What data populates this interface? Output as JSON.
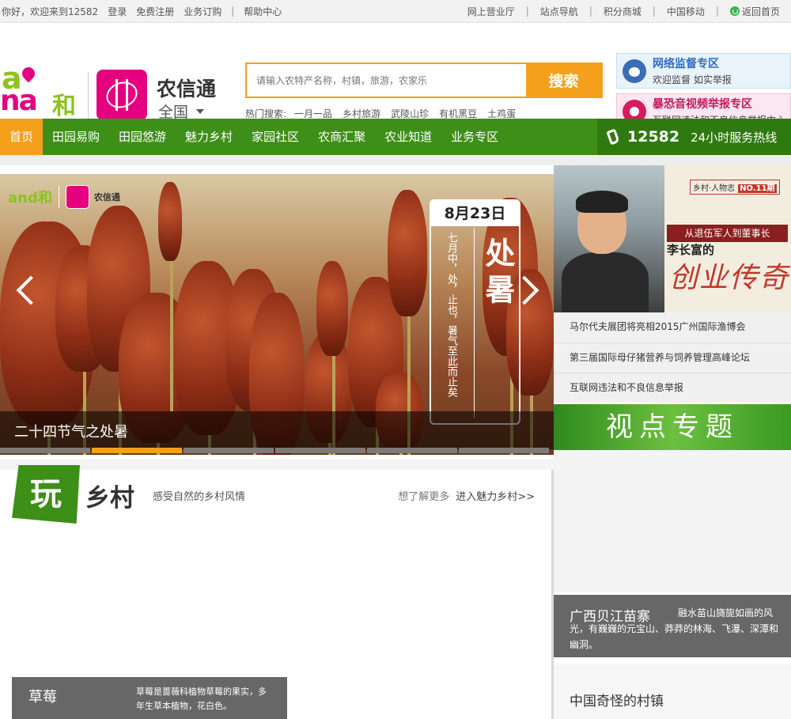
{
  "topbar": {
    "welcome": "你好，欢迎来到12582",
    "login": "登录",
    "register": "免费注册",
    "subscribe": "业务订购",
    "help": "帮助中心",
    "hall": "网上营业厅",
    "sitenav": "站点导航",
    "points": "积分商城",
    "cmcc": "中国移动",
    "home": "返回首页"
  },
  "header": {
    "logo_a": "a",
    "logo_na": "na",
    "logo_he": "和",
    "brand": "农信通",
    "region": "全国",
    "search_placeholder": "请输入农特产名称，村镇，旅游，农家乐",
    "search_button": "搜索",
    "hot_label": "热门搜索:",
    "hot_items": [
      "一月一品",
      "乡村旅游",
      "武陵山珍",
      "有机黑豆",
      "土鸡蛋"
    ]
  },
  "promos": [
    {
      "title": "网络监督专区",
      "subtitle": "欢迎监督 如实举报"
    },
    {
      "title": "暴恐音视频举报专区",
      "subtitle": "互联网违法和不良信息举报中心"
    }
  ],
  "nav": {
    "items": [
      "首页",
      "田园易购",
      "田园悠游",
      "魅力乡村",
      "家园社区",
      "农商汇聚",
      "农业知道",
      "业务专区"
    ],
    "hotline_number": "12582",
    "hotline_text": "24小时服务热线"
  },
  "slider": {
    "logo_and": "and和",
    "logo_name": "农信通",
    "date": "8月23日",
    "poem": "七月中，处，止也，暑气至此而止矣",
    "term": "处暑",
    "caption": "二十四节气之处暑",
    "active_index": 1,
    "dot_count": 6
  },
  "feature": {
    "magazine": "乡村·人物志",
    "issue": "NO.11期",
    "subtitle": "从退伍军人到董事长",
    "name": "李长富的",
    "headline": "创业传奇"
  },
  "news": [
    "马尔代夫展团将亮相2015广州国际渔博会",
    "第三届国际母仔猪营养与饲养管理高峰论坛",
    "互联网违法和不良信息举报"
  ],
  "topic": "视点专题",
  "section": {
    "badge": "玩",
    "title": "乡村",
    "desc": "感受自然的乡村风情",
    "more": "想了解更多",
    "go": "进入魅力乡村>>"
  },
  "cards": {
    "strawberry_title": "草莓",
    "strawberry_desc": "草莓是蔷薇科植物草莓的果实，多年生草本植物，花白色。",
    "village_title": "广西贝江苗寨",
    "village_desc": "融水苗山旖旎如画的风光，有巍巍的元宝山、莽莽的林海、飞瀑、深潭和幽洞。",
    "strange_title": "中国奇怪的村镇"
  }
}
